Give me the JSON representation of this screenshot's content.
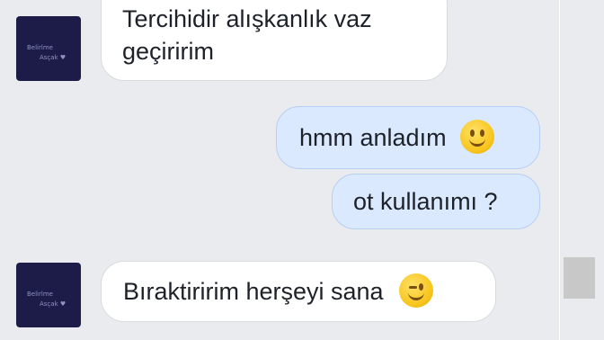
{
  "messages": [
    {
      "direction": "incoming",
      "lines": [
        "Tercihidir alışkanlık vaz",
        "geçiririm"
      ]
    },
    {
      "direction": "outgoing",
      "text": "hmm anladım",
      "emoji": "smile-emoji"
    },
    {
      "direction": "outgoing",
      "text": "ot kullanımı ?"
    },
    {
      "direction": "incoming",
      "text": "Bıraktiririm herşeyi sana",
      "emoji": "wink-emoji"
    }
  ],
  "avatar": {
    "line1": "Belirlme",
    "line2": "Asçak ♥"
  },
  "colors": {
    "background": "#e9ebee",
    "incoming_bubble": "#ffffff",
    "outgoing_bubble": "#dbe9ff",
    "avatar_bg": "#1d1b47"
  }
}
